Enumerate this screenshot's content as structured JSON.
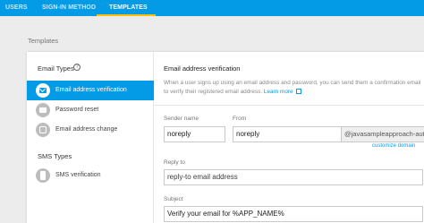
{
  "tabs": [
    {
      "label": "USERS",
      "active": false
    },
    {
      "label": "SIGN-IN METHOD",
      "active": false
    },
    {
      "label": "TEMPLATES",
      "active": true
    }
  ],
  "page_label": "Templates",
  "left_panel": {
    "email_types_title": "Email Types",
    "help_glyph": "?",
    "email_items": [
      {
        "label": "Email address verification",
        "icon": "envelope-icon",
        "active": true
      },
      {
        "label": "Password reset",
        "icon": "key-icon",
        "active": false
      },
      {
        "label": "Email address change",
        "icon": "email-change-icon",
        "active": false
      }
    ],
    "sms_types_title": "SMS Types",
    "sms_items": [
      {
        "label": "SMS verification",
        "icon": "phone-icon",
        "active": false
      }
    ]
  },
  "right_panel": {
    "title": "Email address verification",
    "description": "When a user signs up using an email address and password, you can send them a confirmation email to verify their registered email address.",
    "learn_more": "Learn more",
    "sender_name_label": "Sender name",
    "sender_name_value": "noreply",
    "from_label": "From",
    "from_value": "noreply",
    "from_domain": "@javasampleapproach-auth.fi",
    "customize_domain": "customize domain",
    "reply_to_label": "Reply to",
    "reply_to_value": "reply-to email address",
    "subject_label": "Subject",
    "subject_value": "Verify your email for %APP_NAME%"
  },
  "colors": {
    "brand": "#039be5",
    "tab_indicator": "#ffc107",
    "background": "#ececec"
  }
}
